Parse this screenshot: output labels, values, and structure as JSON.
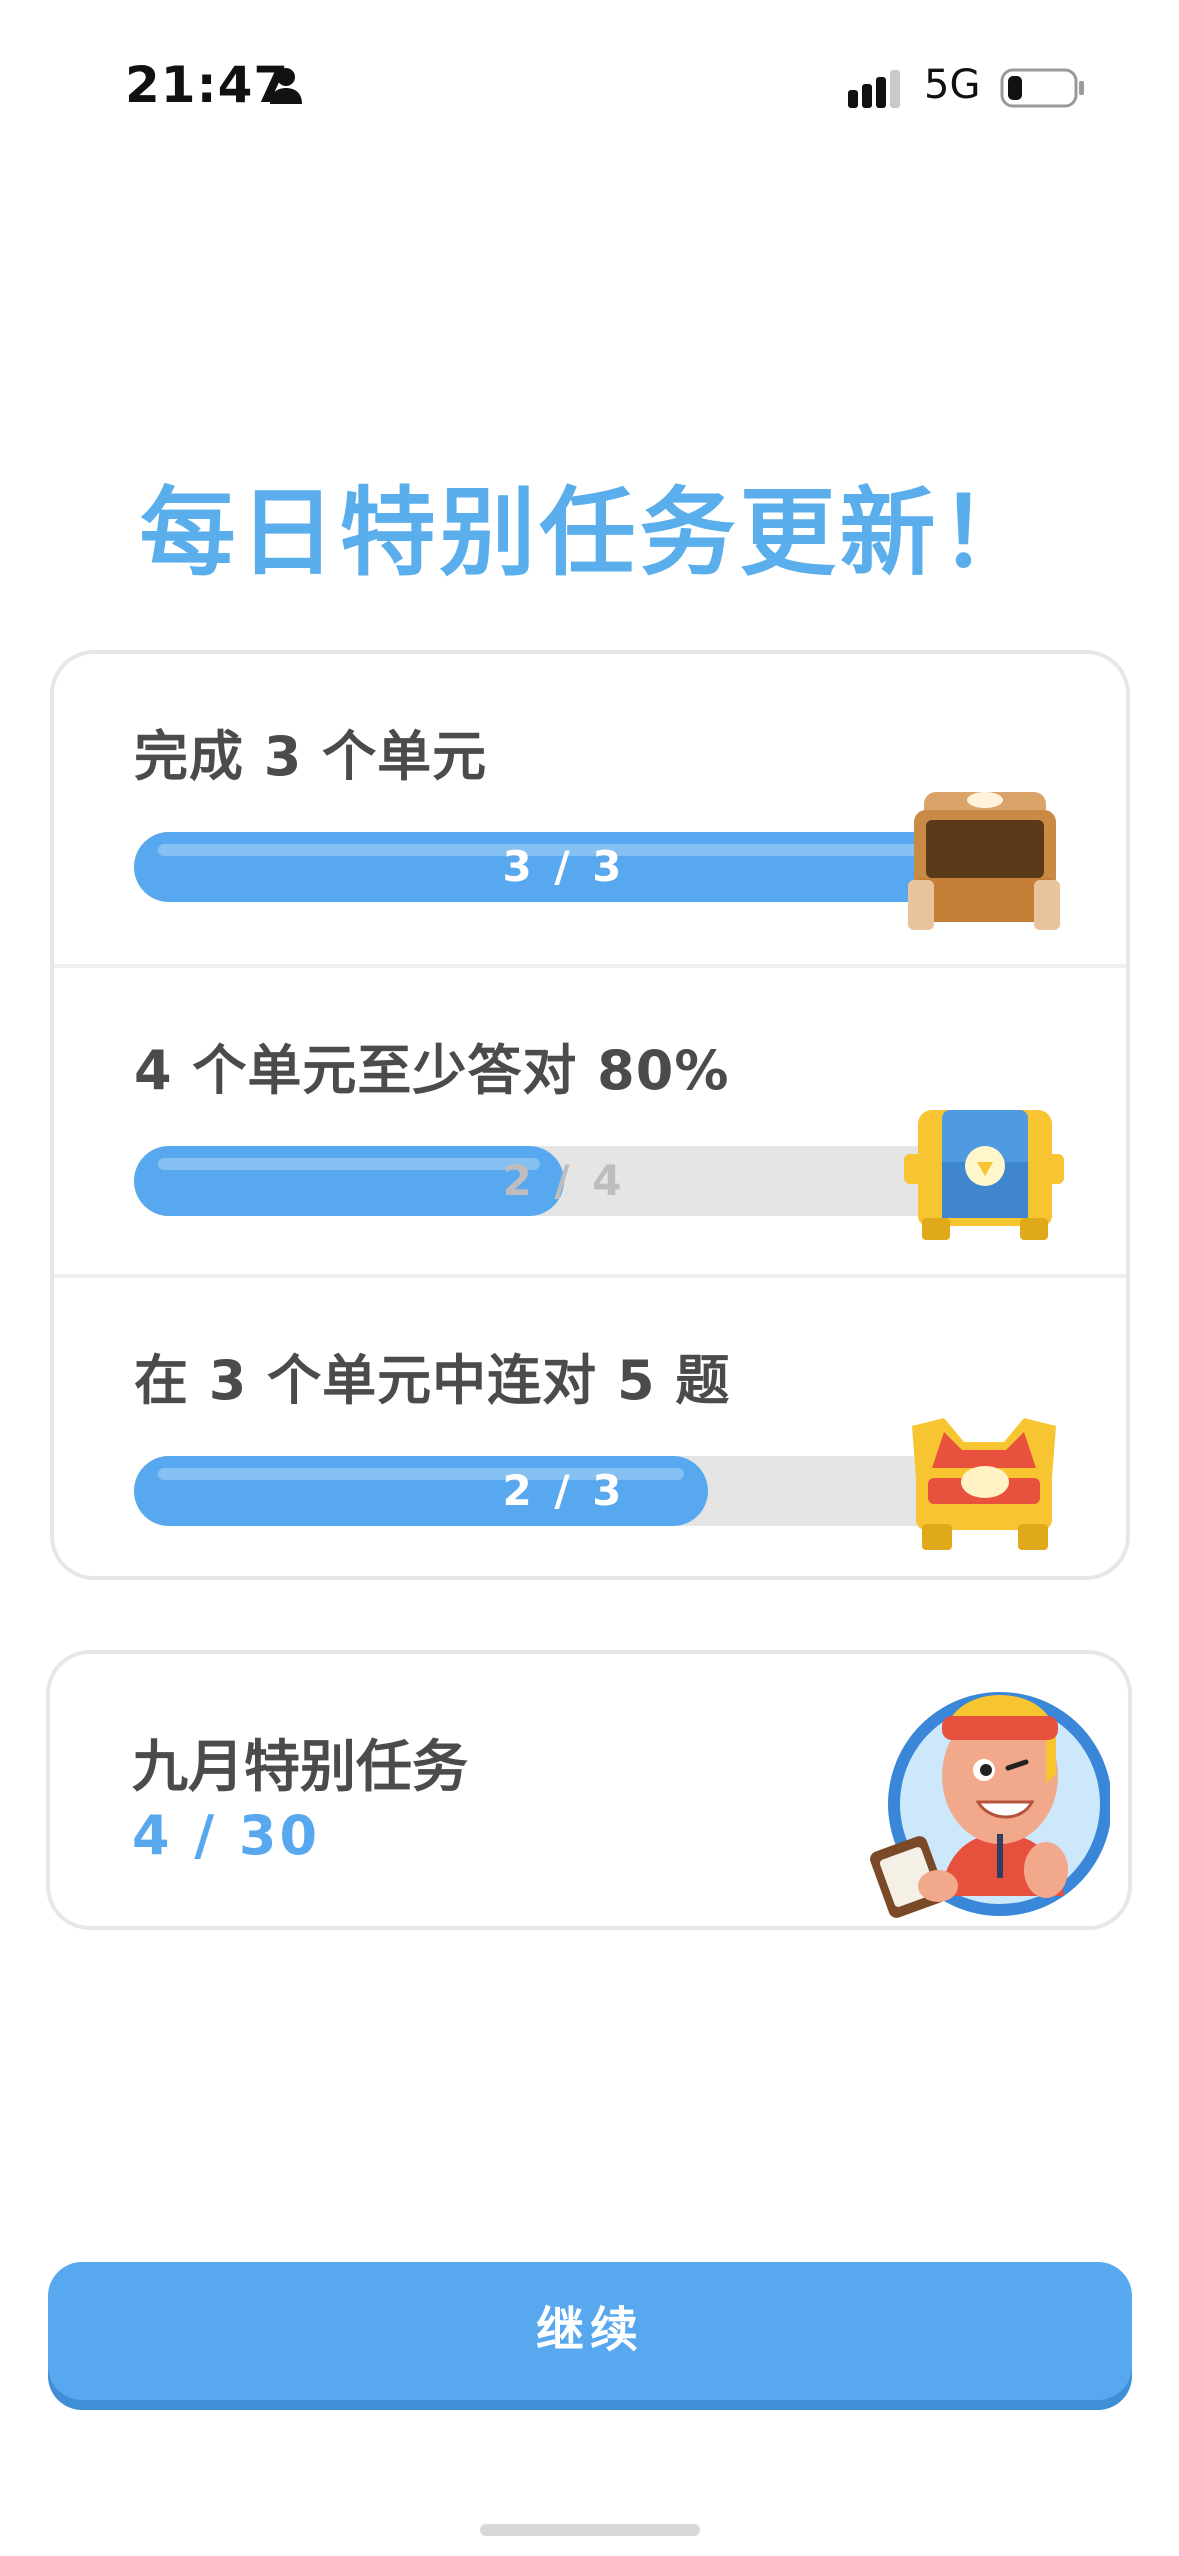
{
  "status_bar": {
    "time": "21:47",
    "network": "5G",
    "icons": [
      "person-icon",
      "signal-icon",
      "battery-icon"
    ]
  },
  "title": "每日特别任务更新！",
  "quests": [
    {
      "title": "完成 3 个单元",
      "progress_text": "3 / 3",
      "progress": 1.0,
      "chest": "opened-brown-chest-icon"
    },
    {
      "title": "4 个单元至少答对 80%",
      "progress_text": "2 / 4",
      "progress": 0.5,
      "chest": "blue-gold-chest-icon"
    },
    {
      "title": "在 3 个单元中连对 5 题",
      "progress_text": "2 / 3",
      "progress": 0.667,
      "chest": "red-gold-chest-icon"
    }
  ],
  "monthly": {
    "title": "九月特别任务",
    "progress_text": "4 / 30",
    "avatar": "mascot-character-icon"
  },
  "continue_button": {
    "label": "继续"
  },
  "colors": {
    "accent": "#57a8ee",
    "title": "#5aaeec",
    "track": "#e5e5e5",
    "text": "#4b4b4b",
    "border": "#e7e7e7"
  }
}
